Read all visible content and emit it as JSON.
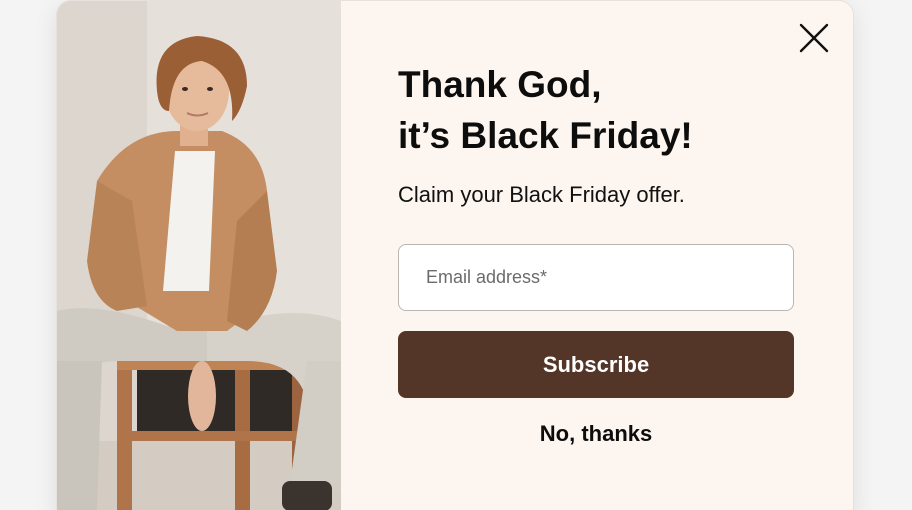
{
  "popup": {
    "headline_line1": "Thank God,",
    "headline_line2": "it’s Black Friday!",
    "subtitle": "Claim your Black Friday offer.",
    "email_placeholder": "Email address*",
    "email_value": "",
    "subscribe_label": "Subscribe",
    "decline_label": "No, thanks",
    "close_icon": "close-x-icon",
    "colors": {
      "panel_background": "#fdf6f0",
      "button_background": "#533627",
      "button_text": "#ffffff",
      "text": "#0d0d0d"
    }
  }
}
